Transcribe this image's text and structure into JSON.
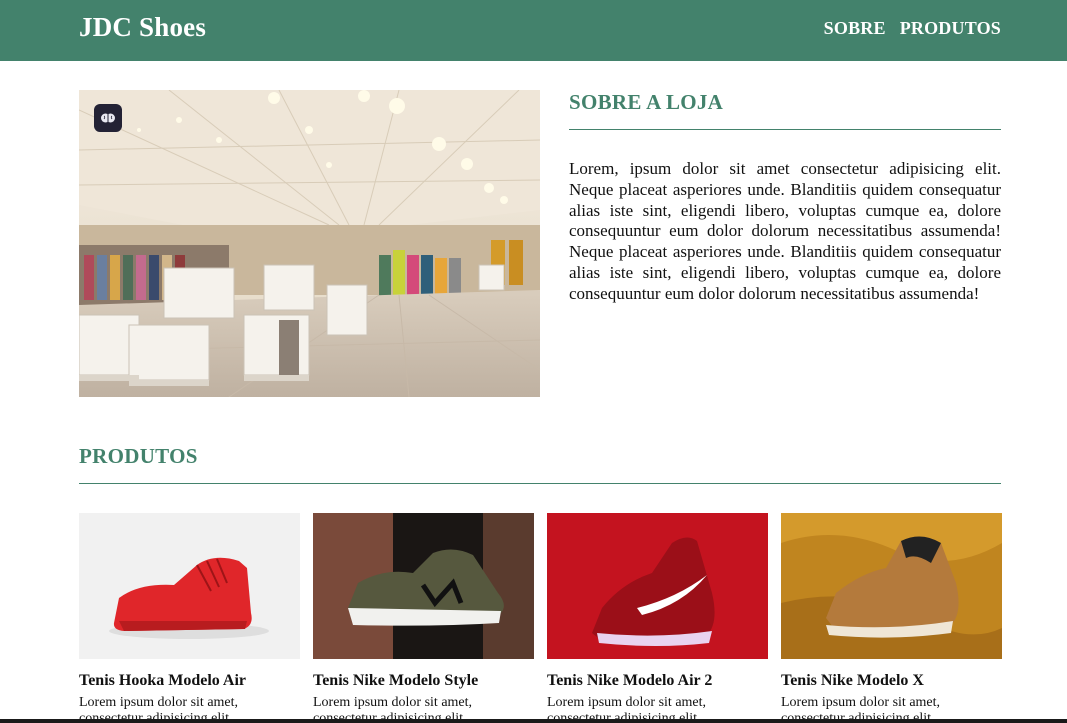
{
  "header": {
    "brand": "JDC Shoes",
    "nav": [
      "SOBRE",
      "PRODUTOS"
    ],
    "bg_color": "#43826c"
  },
  "about": {
    "title": "SOBRE A LOJA",
    "text": "Lorem, ipsum dolor sit amet consectetur adipisicing elit. Neque placeat asperiores unde. Blanditiis quidem consequatur alias iste sint, eligendi libero, voluptas cumque ea, dolore consequuntur eum dolor dolorum necessitatibus assumenda! Neque placeat asperiores unde. Blanditiis quidem consequatur alias iste sint, eligendi libero, voluptas cumque ea, dolore consequuntur eum dolor dolorum necessitatibus assumenda!",
    "image_icon": "brain-icon"
  },
  "products": {
    "title": "PRODUTOS",
    "items": [
      {
        "name": "Tenis Hooka Modelo Air",
        "desc": "Lorem ipsum dolor sit amet, consectetur adipisicing elit."
      },
      {
        "name": "Tenis Nike Modelo Style",
        "desc": "Lorem ipsum dolor sit amet, consectetur adipisicing elit."
      },
      {
        "name": "Tenis Nike Modelo Air 2",
        "desc": "Lorem ipsum dolor sit amet, consectetur adipisicing elit."
      },
      {
        "name": "Tenis Nike Modelo X",
        "desc": "Lorem ipsum dolor sit amet, consectetur adipisicing elit."
      }
    ]
  },
  "accent_color": "#43826c"
}
